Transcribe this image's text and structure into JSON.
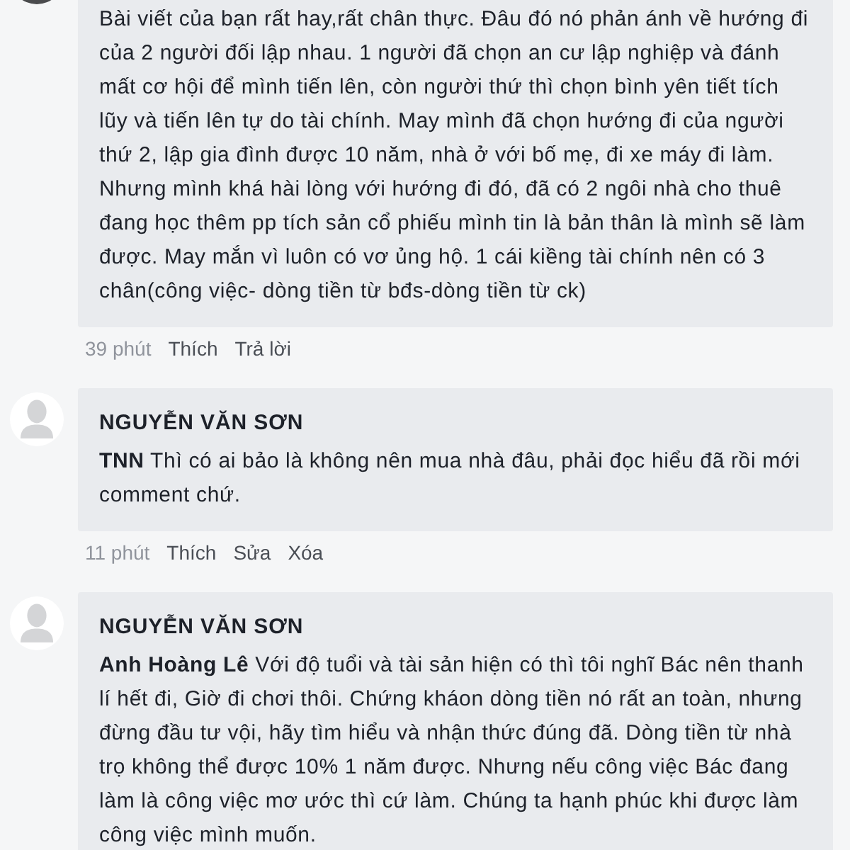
{
  "comments": [
    {
      "avatar": {
        "kind": "photo"
      },
      "text": "Bài viết của bạn rất hay,rất chân thực. Đâu đó nó phản ánh về hướng đi của 2 người đối lập nhau. 1 người đã chọn an cư lập nghiệp và đánh mất cơ hội để mình tiến lên, còn người thứ thì chọn bình yên tiết tích lũy và tiến lên tự do tài chính. May mình đã chọn hướng đi của người thứ 2, lập gia đình được 10 năm, nhà ở với bố mẹ, đi xe máy đi làm. Nhưng mình khá hài lòng với hướng đi đó, đã có 2 ngôi nhà cho thuê đang học thêm pp tích sản cổ phiếu mình tin là bản thân là mình sẽ làm được. May mắn vì luôn có vơ ủng hộ. 1 cái kiềng tài chính nên có 3 chân(công việc- dòng tiền từ bđs-dòng tiền từ ck)",
      "time": "39 phút",
      "actions": [
        "Thích",
        "Trả lời"
      ]
    },
    {
      "avatar": {
        "kind": "default"
      },
      "author": "NGUYỄN VĂN SƠN",
      "text": "**TNN** Thì có ai bảo là không nên mua nhà đâu, phải đọc hiểu đã rồi mới comment chứ.",
      "time": "11 phút",
      "actions": [
        "Thích",
        "Sửa",
        "Xóa"
      ]
    },
    {
      "avatar": {
        "kind": "default"
      },
      "author": "NGUYỄN VĂN SƠN",
      "text": "**Anh Hoàng Lê** Với độ tuổi và tài sản hiện có thì tôi nghĩ Bác nên thanh lí hết đi, Giờ đi chơi thôi. Chứng kháon dòng tiền nó rất an toàn, nhưng đừng đầu tư vội, hãy tìm hiểu và nhận thức đúng đã. Dòng tiền từ nhà trọ không thể được 10% 1 năm được. Nhưng nếu công việc Bác đang làm là công việc mơ ước thì cứ làm. Chúng ta hạnh phúc khi được làm công việc mình muốn."
    }
  ]
}
